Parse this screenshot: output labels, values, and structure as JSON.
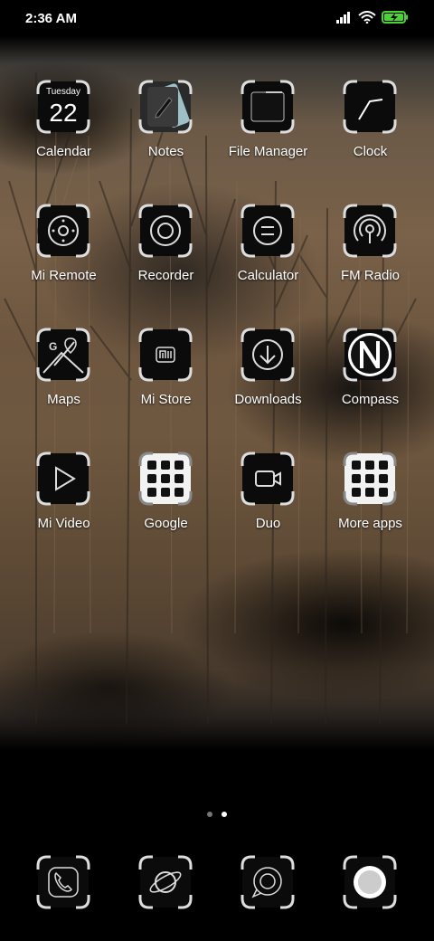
{
  "status_bar": {
    "time": "2:36 AM",
    "icons": [
      "signal-icon",
      "wifi-icon",
      "battery-charging-icon"
    ],
    "battery_color": "#4cd137"
  },
  "apps": [
    {
      "label": "Calendar",
      "icon": "calendar-icon",
      "weekday": "Tuesday",
      "day": "22"
    },
    {
      "label": "Notes",
      "icon": "notes-icon"
    },
    {
      "label": "File Manager",
      "icon": "folder-icon"
    },
    {
      "label": "Clock",
      "icon": "clock-icon"
    },
    {
      "label": "Mi Remote",
      "icon": "remote-icon"
    },
    {
      "label": "Recorder",
      "icon": "recorder-icon"
    },
    {
      "label": "Calculator",
      "icon": "calculator-icon"
    },
    {
      "label": "FM Radio",
      "icon": "radio-icon"
    },
    {
      "label": "Maps",
      "icon": "maps-icon"
    },
    {
      "label": "Mi Store",
      "icon": "mi-store-icon"
    },
    {
      "label": "Downloads",
      "icon": "download-icon"
    },
    {
      "label": "Compass",
      "icon": "compass-icon"
    },
    {
      "label": "Mi Video",
      "icon": "play-icon"
    },
    {
      "label": "Google",
      "icon": "folder-grid-icon"
    },
    {
      "label": "Duo",
      "icon": "video-camera-icon"
    },
    {
      "label": "More apps",
      "icon": "folder-grid-icon"
    }
  ],
  "pager": {
    "pages": 2,
    "current": 2
  },
  "dock": [
    {
      "icon": "phone-icon"
    },
    {
      "icon": "browser-planet-icon"
    },
    {
      "icon": "messages-icon"
    },
    {
      "icon": "camera-icon"
    }
  ]
}
